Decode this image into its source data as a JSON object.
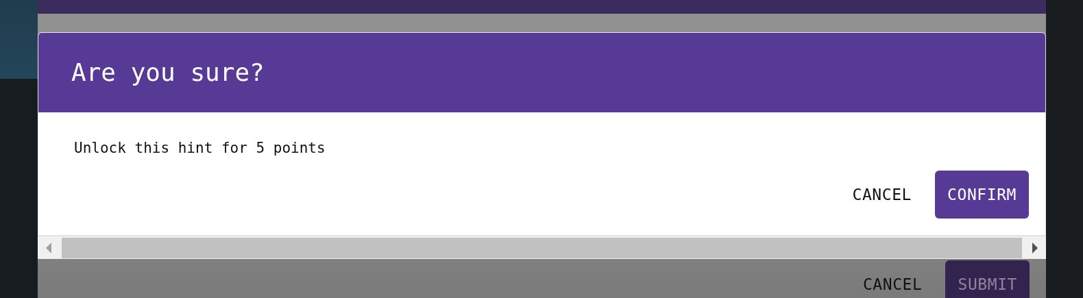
{
  "dialog": {
    "title": "Are you sure?",
    "message": "Unlock this hint for 5 points",
    "buttons": [
      {
        "label": "CANCEL",
        "kind": "text"
      },
      {
        "label": "CONFIRM",
        "kind": "primary"
      }
    ]
  },
  "background_buttons": [
    {
      "label": "CANCEL",
      "kind": "text"
    },
    {
      "label": "SUBMIT",
      "kind": "primary"
    }
  ]
}
